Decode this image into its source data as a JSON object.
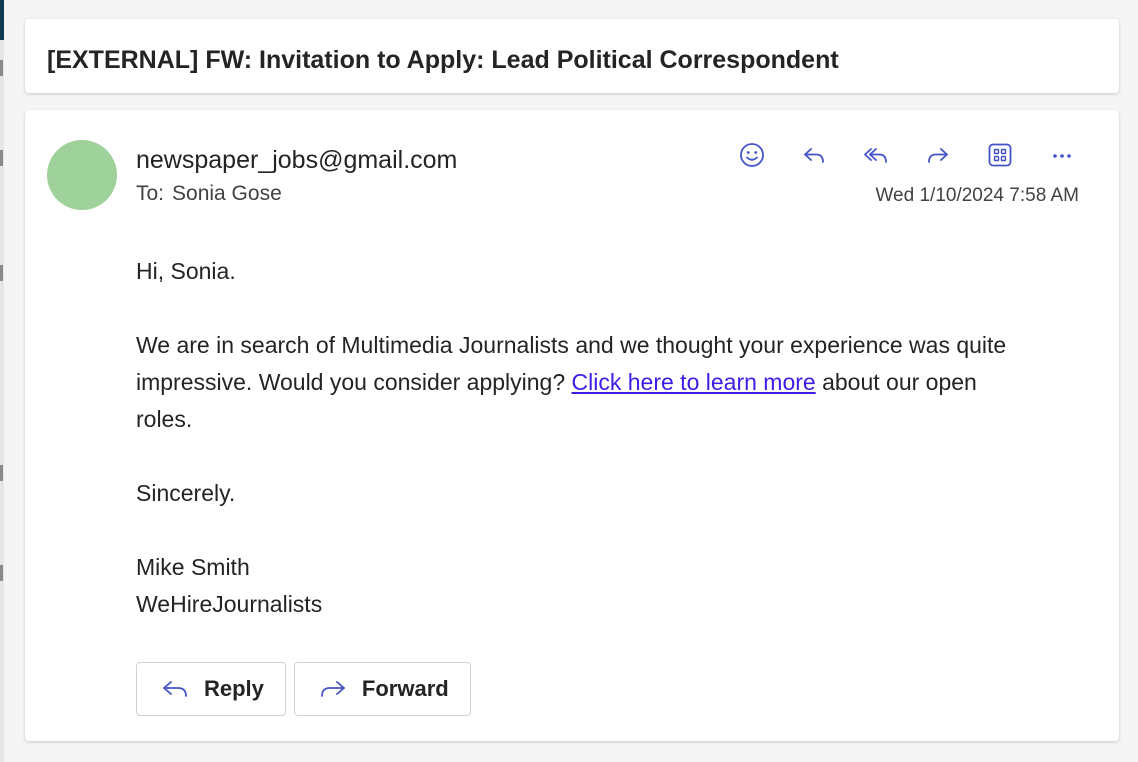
{
  "subject": "[EXTERNAL] FW: Invitation to Apply: Lead Political Correspondent",
  "sender": {
    "email": "newspaper_jobs@gmail.com",
    "avatar_color": "#9fd19a"
  },
  "recipient": {
    "label": "To:",
    "name": "Sonia Gose"
  },
  "timestamp": "Wed 1/10/2024 7:58 AM",
  "toolbar": {
    "icons": [
      "emoji-icon",
      "reply-icon",
      "reply-all-icon",
      "forward-icon",
      "apps-icon",
      "more-icon"
    ]
  },
  "body": {
    "greeting": "Hi, Sonia.",
    "paragraph_start": "We are in search of Multimedia Journalists and we thought your experience was quite impressive. Would you consider applying? ",
    "link_text": "Click here to learn more",
    "paragraph_end": " about our open roles.",
    "closing": "Sincerely.",
    "signature_name": "Mike Smith",
    "signature_company": "WeHireJournalists",
    "link_color": "#3a1ee8"
  },
  "actions": {
    "reply_label": "Reply",
    "forward_label": "Forward"
  }
}
